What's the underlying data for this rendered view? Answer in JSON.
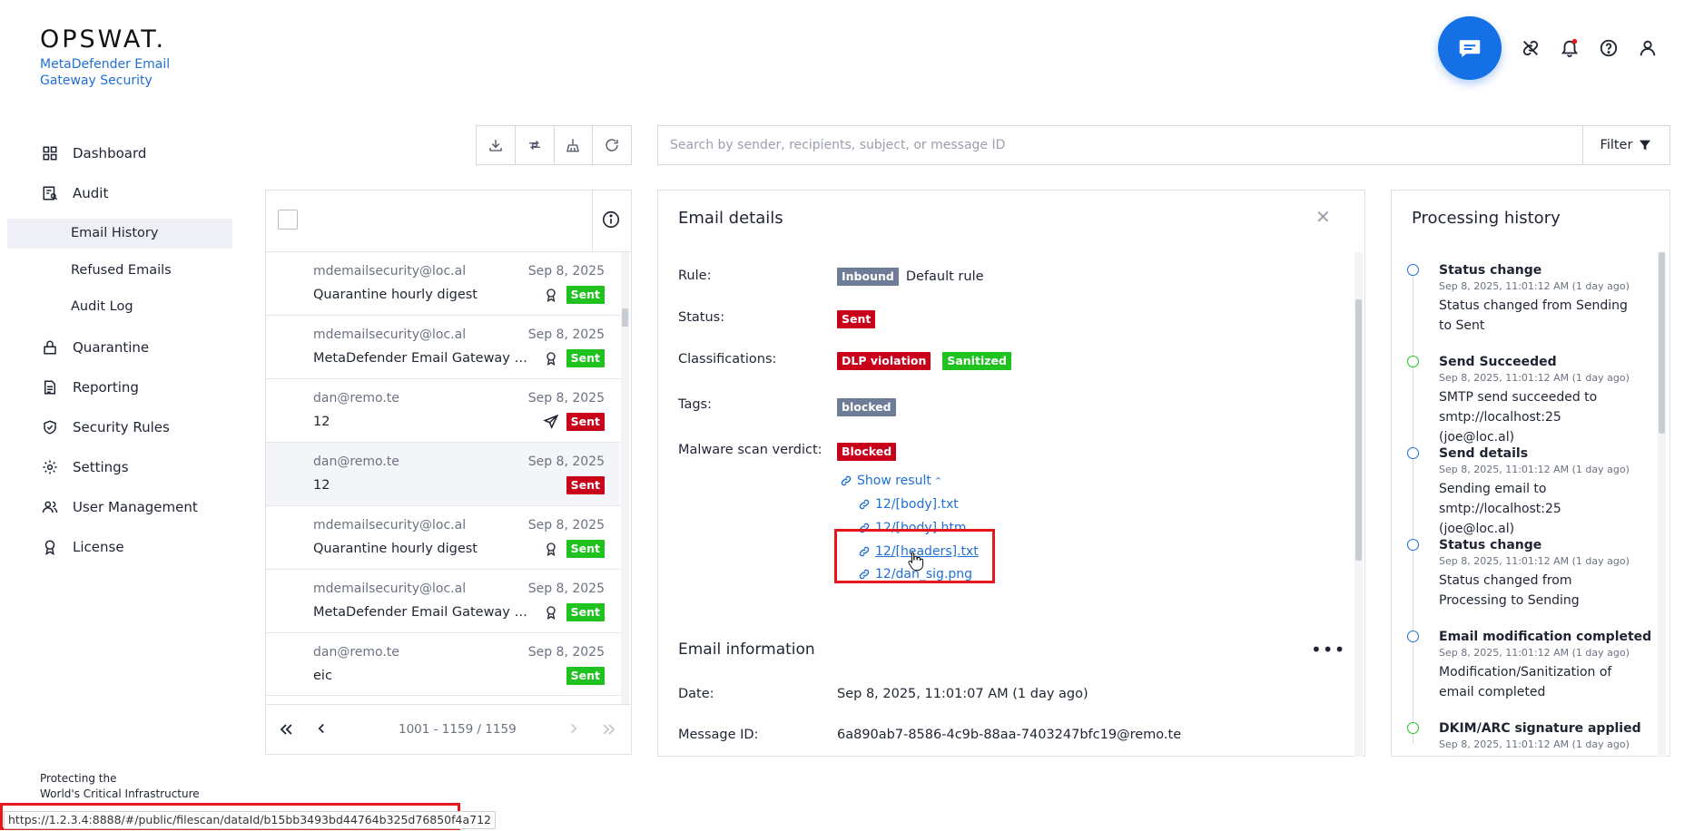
{
  "brand": {
    "logo": "OPSWAT.",
    "product": "MetaDefender Email Gateway Security",
    "tagline_1": "Protecting the",
    "tagline_2": "World's Critical Infrastructure"
  },
  "sidebar": {
    "dashboard": "Dashboard",
    "audit": "Audit",
    "email_history": "Email History",
    "refused_emails": "Refused Emails",
    "audit_log": "Audit Log",
    "quarantine": "Quarantine",
    "reporting": "Reporting",
    "security_rules": "Security Rules",
    "settings": "Settings",
    "user_management": "User Management",
    "license": "License"
  },
  "search": {
    "placeholder": "Search by sender, recipients, subject, or message ID"
  },
  "filter_label": "Filter",
  "emails": [
    {
      "from": "mdemailsecurity@loc.al",
      "subject": "Quarantine hourly digest",
      "date": "Sep 8, 2025",
      "status": "Sent",
      "icon": "award-icon"
    },
    {
      "from": "mdemailsecurity@loc.al",
      "subject": "MetaDefender Email Gateway Security Report",
      "date": "Sep 8, 2025",
      "status": "Sent",
      "icon": "award-icon"
    },
    {
      "from": "dan@remo.te",
      "subject": "12",
      "date": "Sep 8, 2025",
      "status": "Sent",
      "icon": "send-icon"
    },
    {
      "from": "dan@remo.te",
      "subject": "12",
      "date": "Sep 8, 2025",
      "status": "Sent",
      "icon": ""
    },
    {
      "from": "mdemailsecurity@loc.al",
      "subject": "Quarantine hourly digest",
      "date": "Sep 8, 2025",
      "status": "Sent",
      "icon": "award-icon"
    },
    {
      "from": "mdemailsecurity@loc.al",
      "subject": "MetaDefender Email Gateway Security Report",
      "date": "Sep 8, 2025",
      "status": "Sent",
      "icon": "award-icon"
    },
    {
      "from": "dan@remo.te",
      "subject": "eic",
      "date": "Sep 8, 2025",
      "status": "Sent",
      "icon": ""
    }
  ],
  "pager": {
    "range": "1001 - 1159 / 1159"
  },
  "details": {
    "title": "Email details",
    "rule_label": "Rule:",
    "rule_badge": "Inbound",
    "rule_value": "Default rule",
    "status_label": "Status:",
    "status_badge": "Sent",
    "classifications_label": "Classifications:",
    "class_1": "DLP violation",
    "class_2": "Sanitized",
    "tags_label": "Tags:",
    "tag_1": "blocked",
    "malware_label": "Malware scan verdict:",
    "malware_badge": "Blocked",
    "show_result": "Show result",
    "files": [
      "12/[body].txt",
      "12/[body].htm",
      "12/[headers].txt",
      "12/dan_sig.png"
    ],
    "info_title": "Email information",
    "date_label": "Date:",
    "date_value": "Sep 8, 2025, 11:01:07 AM (1 day ago)",
    "msgid_label": "Message ID:",
    "msgid_value": "6a890ab7-8586-4c9b-88aa-7403247bfc19@remo.te"
  },
  "history": {
    "title": "Processing history",
    "items": [
      {
        "title": "Status change",
        "time": "Sep 8, 2025, 11:01:12 AM (1 day ago)",
        "desc": "Status changed from Sending to Sent",
        "color": "#1f6fd6"
      },
      {
        "title": "Send Succeeded",
        "time": "Sep 8, 2025, 11:01:12 AM (1 day ago)",
        "desc": "SMTP send succeeded to smtp://localhost:25 (joe@loc.al)",
        "color": "#1fc21f"
      },
      {
        "title": "Send details",
        "time": "Sep 8, 2025, 11:01:12 AM (1 day ago)",
        "desc": "Sending email to smtp://localhost:25 (joe@loc.al)",
        "color": "#1f6fd6"
      },
      {
        "title": "Status change",
        "time": "Sep 8, 2025, 11:01:12 AM (1 day ago)",
        "desc": "Status changed from Processing to Sending",
        "color": "#1f6fd6"
      },
      {
        "title": "Email modification completed",
        "time": "Sep 8, 2025, 11:01:12 AM (1 day ago)",
        "desc": "Modification/Sanitization of email completed",
        "color": "#1f6fd6"
      },
      {
        "title": "DKIM/ARC signature applied",
        "time": "Sep 8, 2025, 11:01:12 AM (1 day ago)",
        "desc": "",
        "color": "#1fc21f"
      }
    ]
  },
  "status_bar_url": "https://1.2.3.4:8888/#/public/filescan/dataId/b15bb3493bd44764b325d76850f4a712",
  "colors": {
    "accent": "#1470e4",
    "sent": "#1fc21f",
    "blocked": "#c8001a",
    "highlight": "#e5161c"
  }
}
